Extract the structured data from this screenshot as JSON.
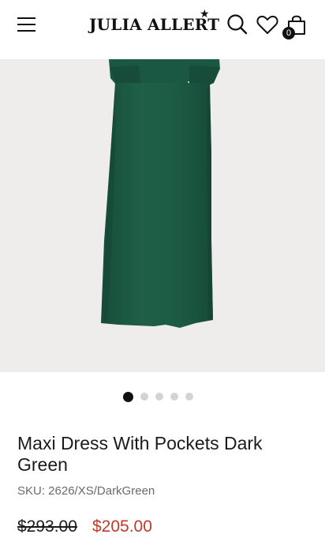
{
  "header": {
    "logo_text": "JULIA ALLERT",
    "logo_star": "★",
    "cart_count": "0"
  },
  "product": {
    "title": "Maxi Dress With Pockets Dark Green",
    "sku": "SKU: 2626/XS/DarkGreen",
    "price_original": "$293.00",
    "price_sale": "$205.00"
  },
  "carousel": {
    "total_slides": 5,
    "active_slide": 1
  },
  "colors": {
    "dress": "#1d5b45",
    "sale_price": "#c0392b",
    "image_background": "#efedec"
  },
  "icons": [
    "menu-icon",
    "search-icon",
    "heart-icon",
    "shopping-bag-icon"
  ]
}
